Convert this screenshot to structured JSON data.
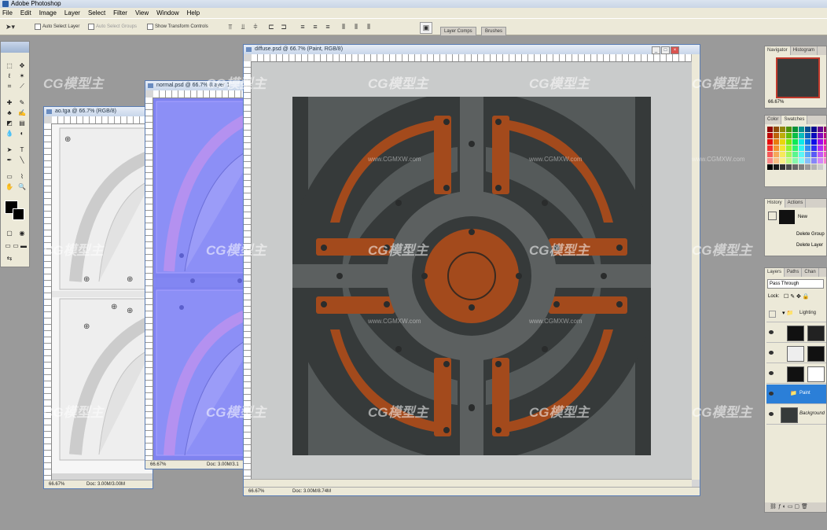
{
  "app": {
    "title": "Adobe Photoshop"
  },
  "menu": [
    "File",
    "Edit",
    "Image",
    "Layer",
    "Select",
    "Filter",
    "View",
    "Window",
    "Help"
  ],
  "options": {
    "auto_select_layer": "Auto Select Layer",
    "auto_select_groups": "Auto Select Groups",
    "show_transform_controls": "Show Transform Controls",
    "well_tabs": [
      "Layer Comps",
      "Brushes"
    ]
  },
  "documents": {
    "ao": {
      "title": "ao.tga @ 66.7% (RGB/8)",
      "zoom": "66.67%",
      "doc_size": "Doc: 3.00M/3.00M"
    },
    "normal": {
      "title": "normal.psd @ 66.7% (Layer 1",
      "zoom": "66.67%",
      "doc_size": "Doc: 3.00M/3.1"
    },
    "diffuse": {
      "title": "diffuse.psd @ 66.7% (Paint, RGB/8)",
      "zoom": "66.67%",
      "doc_size": "Doc: 3.00M/8.74M"
    }
  },
  "palettes": {
    "navigator": {
      "tabs": [
        "Navigator",
        "Histogram"
      ],
      "zoom": "66.67%"
    },
    "color": {
      "tabs": [
        "Color",
        "Swatches"
      ]
    },
    "history": {
      "tabs": [
        "History",
        "Actions"
      ],
      "items": [
        "New",
        "Delete Group",
        "Delete Layer"
      ]
    },
    "layers": {
      "tabs": [
        "Layers",
        "Paths",
        "Chan"
      ],
      "blend_mode": "Pass Through",
      "lock_label": "Lock:",
      "items": [
        "Lighting",
        "",
        "",
        "",
        "Paint",
        "Background"
      ]
    }
  },
  "watermark": {
    "brand": "CG模型主",
    "url": "www.CGMXW.com"
  },
  "colors": {
    "accent": "#2b7fd8",
    "orange": "#a34a1c",
    "plate": "#363a3a",
    "mid_gray": "#5c6060"
  }
}
